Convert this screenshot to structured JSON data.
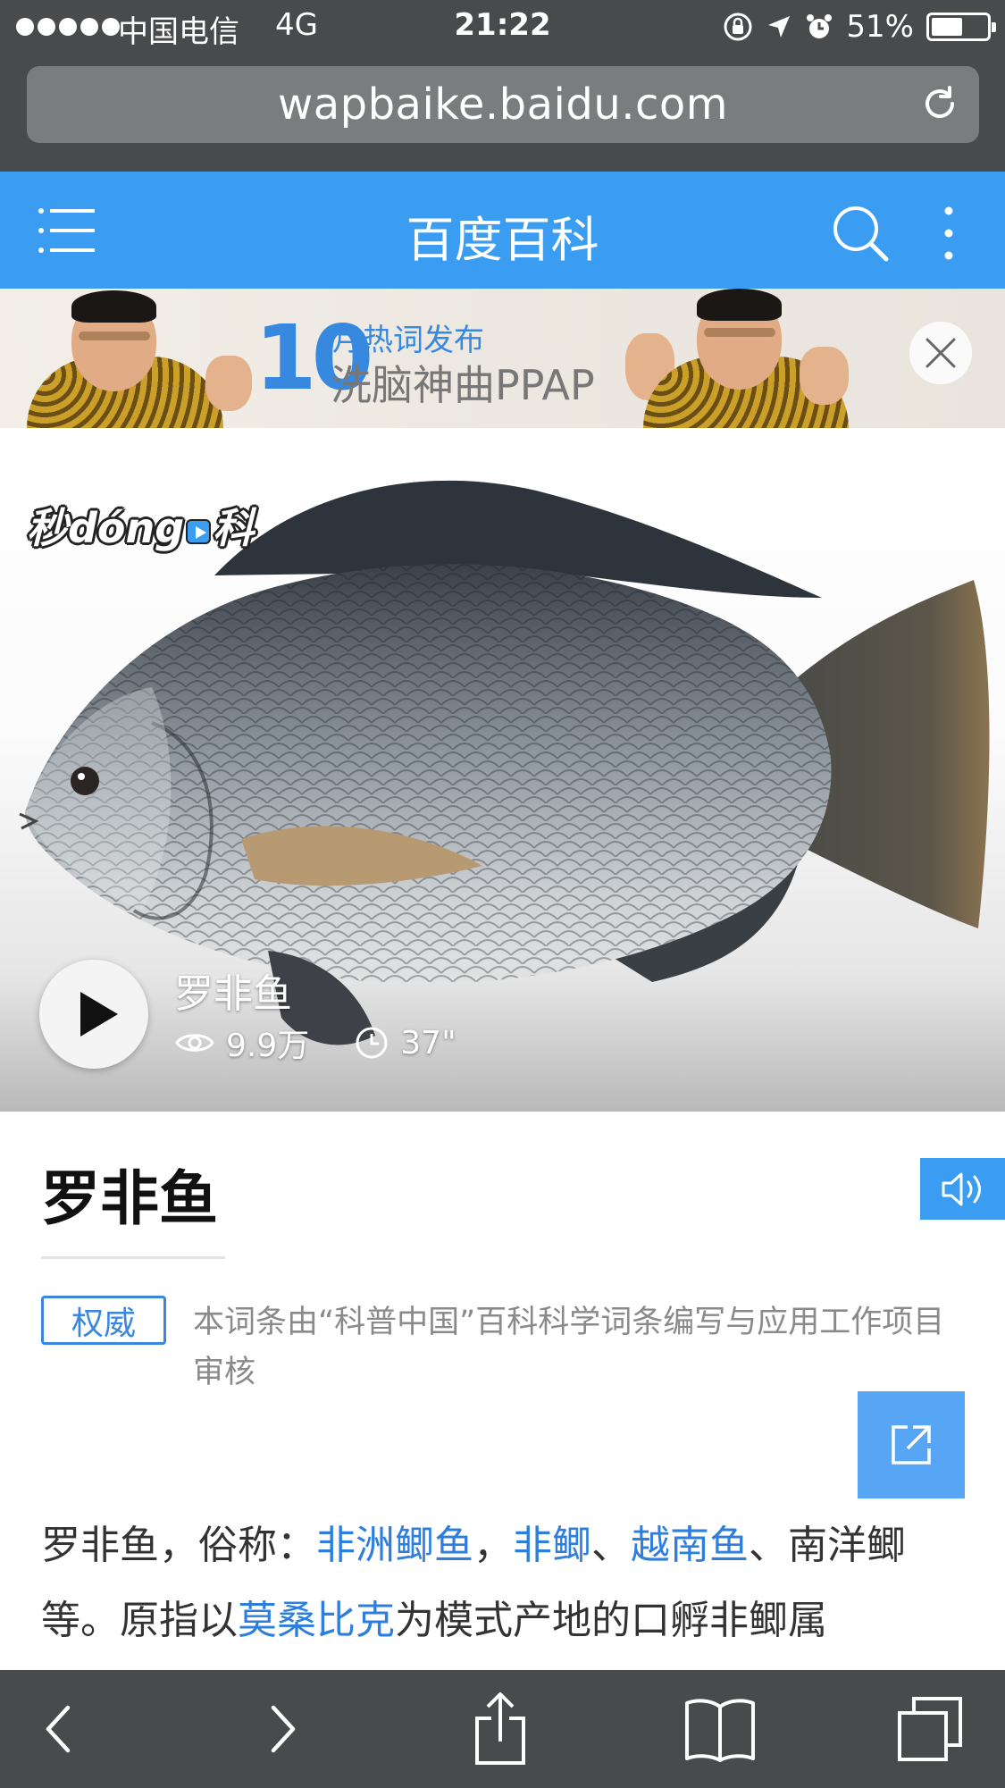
{
  "status_bar": {
    "carrier": "中国电信",
    "network": "4G",
    "time": "21:22",
    "battery": "51%",
    "battery_level": 0.51
  },
  "browser": {
    "url": "wapbaike.baidu.com"
  },
  "header": {
    "title": "百度百科"
  },
  "banner": {
    "number": "10",
    "line1": "月热词发布",
    "line2": "洗脑神曲PPAP"
  },
  "video": {
    "logo": "秒dóng百科",
    "logo_prefix": "秒dóng",
    "logo_suffix": "科",
    "title": "罗非鱼",
    "views": "9.9万",
    "duration": "37\""
  },
  "entry": {
    "title": "罗非鱼",
    "badge": "权威",
    "authority_text": "本词条由“科普中国”百科科学词条编写与应用工作项目审核",
    "body": {
      "t1": "罗非鱼，俗称：",
      "link1": "非洲鲫鱼",
      "t2": "，",
      "link2": "非鲫",
      "t3": "、",
      "link3": "越南鱼",
      "t4": "、南洋鲫等。原指以",
      "link4": "莫桑比克",
      "t5": "为模式产地的口孵非鲫属"
    }
  },
  "colors": {
    "brand_blue": "#3a9df2",
    "link_blue": "#2e7fdd",
    "chrome_gray": "#484a4c"
  },
  "icons": {
    "menu": "menu-icon",
    "search": "search-icon",
    "more": "more-vertical-icon",
    "close": "close-icon",
    "play": "play-icon",
    "views": "eye-icon",
    "duration": "clock-icon",
    "voice": "speaker-icon",
    "share": "share-out-icon",
    "back": "chevron-left-icon",
    "forward": "chevron-right-icon",
    "share_sheet": "share-icon",
    "bookmarks": "book-icon",
    "tabs": "tabs-icon"
  }
}
